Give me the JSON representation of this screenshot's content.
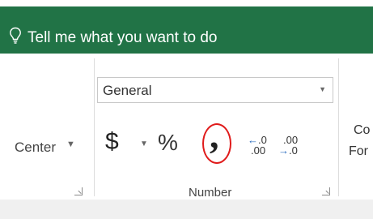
{
  "tell_me": {
    "text": "Tell me what you want to do",
    "icon": "lightbulb-icon"
  },
  "alignment": {
    "merge_center_label": "Center",
    "dropdown_icon": "chevron-down-icon"
  },
  "number_group": {
    "format": {
      "value": "General",
      "dropdown_icon": "chevron-down-icon"
    },
    "accounting_symbol": "$",
    "percent_symbol": "%",
    "comma_symbol": ",",
    "increase_decimal": {
      "top": ".0",
      "bottom": ".00"
    },
    "decrease_decimal": {
      "top": ".00",
      "bottom": ".0"
    },
    "label": "Number",
    "highlight_color": "#e01b1b"
  },
  "styles_partial": {
    "line1": "Co",
    "line2": "For"
  },
  "colors": {
    "ribbon_tab_bar": "#217346",
    "arrow_blue": "#2b6cbf"
  }
}
